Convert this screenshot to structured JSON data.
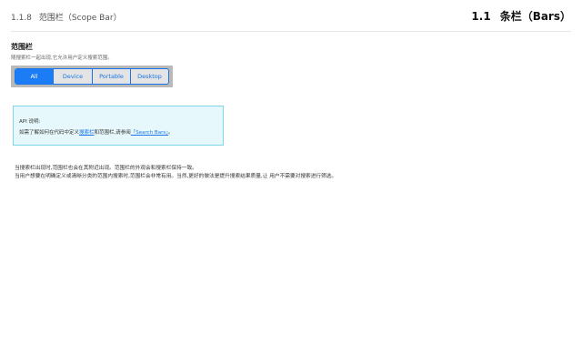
{
  "header": {
    "section_number": "1.1.8",
    "section_title": "范围栏（Scope Bar）",
    "chapter_number": "1.1",
    "chapter_title": "条栏（Bars）"
  },
  "section": {
    "title": "范围栏",
    "subtitle": "随搜索栏一起出现,它允许用户定义搜索范围。"
  },
  "scope_bar": {
    "segments": [
      "All",
      "Device",
      "Portable",
      "Desktop"
    ],
    "selected": "All"
  },
  "note": {
    "title": "API 说明:",
    "body_prefix": "如需了解如何在代码中定义",
    "link_1": "搜索栏",
    "body_middle": "和范围栏,请参阅",
    "link_2": "「Search Bars」",
    "body_suffix": "。"
  },
  "body": {
    "line1": "当搜索栏出现时,范围栏也会在其附近出现。范围栏的外观会和搜索栏保持一致。",
    "line2": "当用户想要在明确定义或清晰分类的范围内搜索时,范围栏会非常有用。当然,更好的做法是提升搜索结果质量,让 用户不需要对搜索进行筛选。"
  }
}
